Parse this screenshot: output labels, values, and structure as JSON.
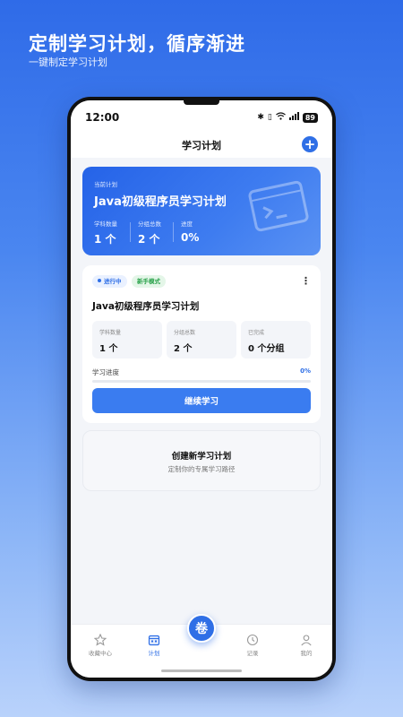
{
  "promo": {
    "title": "定制学习计划，循序渐进",
    "subtitle": "一键制定学习计划"
  },
  "status_bar": {
    "time": "12:00",
    "battery": "89"
  },
  "nav": {
    "title": "学习计划",
    "add_icon": "plus-circle-icon"
  },
  "current_plan": {
    "label": "当前计划",
    "title": "Java初级程序员学习计划",
    "stats": [
      {
        "label": "学科数量",
        "value": "1 个"
      },
      {
        "label": "分组总数",
        "value": "2 个"
      },
      {
        "label": "进度",
        "value": "0%"
      }
    ],
    "icon": "terminal-icon"
  },
  "plan_card": {
    "tags": [
      "进行中",
      "新手模式"
    ],
    "title": "Java初级程序员学习计划",
    "stats": [
      {
        "label": "学科数量",
        "value": "1 个"
      },
      {
        "label": "分组总数",
        "value": "2 个"
      },
      {
        "label": "已完成",
        "value": "0 个分组"
      }
    ],
    "progress_label": "学习进度",
    "progress_value": "0%",
    "progress_fraction": 0,
    "button": "继续学习"
  },
  "create_card": {
    "title": "创建新学习计划",
    "subtitle": "定制你的专属学习路径"
  },
  "tabs": [
    {
      "label": "收藏中心",
      "icon": "star-icon",
      "active": false
    },
    {
      "label": "计划",
      "icon": "calendar-icon",
      "active": true
    },
    {
      "label": "卷",
      "icon": "exam-fab",
      "active": false
    },
    {
      "label": "记录",
      "icon": "clock-icon",
      "active": false
    },
    {
      "label": "我的",
      "icon": "user-icon",
      "active": false
    }
  ],
  "colors": {
    "accent": "#2f6fe6",
    "success": "#2aa24a"
  }
}
